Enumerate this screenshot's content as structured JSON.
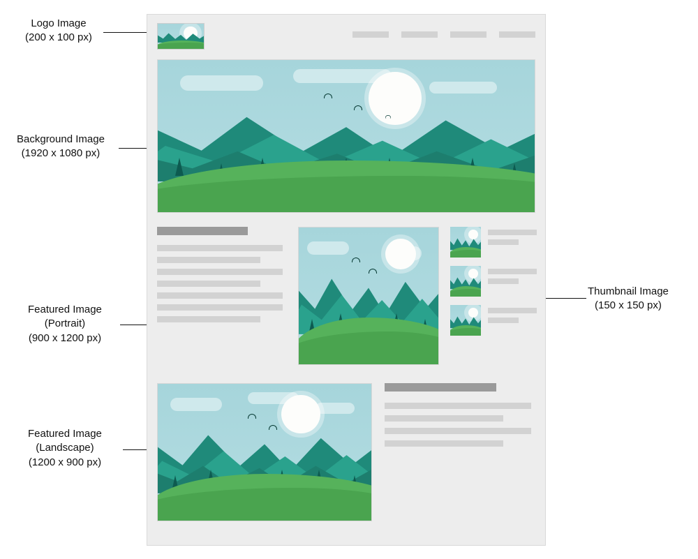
{
  "annotations": {
    "logo": {
      "title": "Logo Image",
      "dims": "(200 x 100 px)"
    },
    "background": {
      "title": "Background Image",
      "dims": "(1920 x 1080 px)"
    },
    "portrait": {
      "title": "Featured Image",
      "subtitle": "(Portrait)",
      "dims": "(900 x 1200 px)"
    },
    "landscape": {
      "title": "Featured Image",
      "subtitle": "(Landscape)",
      "dims": "(1200 x 900 px)"
    },
    "thumbnail": {
      "title": "Thumbnail Image",
      "dims": "(150 x 150 px)"
    }
  }
}
